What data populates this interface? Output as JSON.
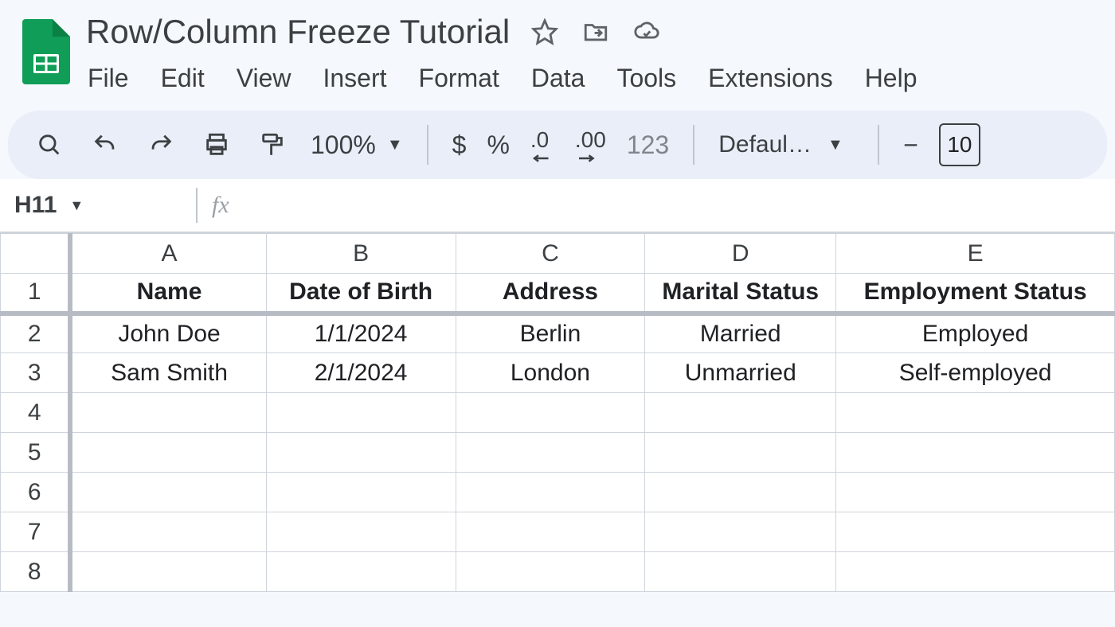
{
  "doc": {
    "title": "Row/Column Freeze Tutorial"
  },
  "menu": {
    "file": "File",
    "edit": "Edit",
    "view": "View",
    "insert": "Insert",
    "format": "Format",
    "data": "Data",
    "tools": "Tools",
    "extensions": "Extensions",
    "help": "Help"
  },
  "toolbar": {
    "zoom": "100%",
    "currency": "$",
    "percent": "%",
    "dec_dec": ".0",
    "dec_inc": ".00",
    "num_format": "123",
    "font_name": "Defaul…",
    "font_size_partial": "10",
    "minus": "−"
  },
  "namebox": {
    "ref": "H11"
  },
  "formula": {
    "value": ""
  },
  "columns": [
    "A",
    "B",
    "C",
    "D",
    "E"
  ],
  "rows": [
    "1",
    "2",
    "3",
    "4",
    "5",
    "6",
    "7",
    "8"
  ],
  "headers": {
    "A": "Name",
    "B": "Date of Birth",
    "C": "Address",
    "D": "Marital Status",
    "E": "Employment Status"
  },
  "data_rows": [
    {
      "A": "John Doe",
      "B": "1/1/2024",
      "C": "Berlin",
      "D": "Married",
      "E": "Employed"
    },
    {
      "A": "Sam Smith",
      "B": "2/1/2024",
      "C": "London",
      "D": "Unmarried",
      "E": "Self-employed"
    }
  ]
}
